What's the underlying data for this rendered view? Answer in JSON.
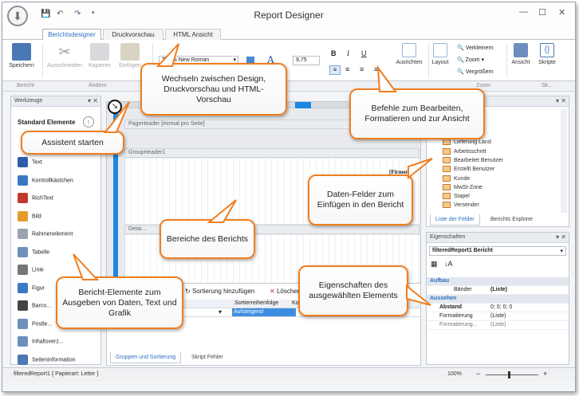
{
  "window": {
    "title": "Report Designer"
  },
  "tabs": [
    "Berichtsdesigner",
    "Druckvorschau",
    "HTML Ansicht"
  ],
  "ribbon": {
    "save": "Speichern",
    "cut": "Ausschneiden",
    "copy": "Kopieren",
    "paste": "Einfügen",
    "font_name": "Times New Roman",
    "font_size": "9,75",
    "bold": "B",
    "italic": "I",
    "underline": "U",
    "align": "Ausrichten",
    "layout": "Layout",
    "zoom_out": "Verkleinern",
    "zoom": "Zoom",
    "zoom_in": "Vergrößern",
    "view": "Ansicht",
    "scripts": "Skripte"
  },
  "groups": {
    "report": "Bericht",
    "edit": "Ändern",
    "zoom": "Zoom",
    "scripts": "Sk..."
  },
  "toolbox": {
    "title": "Werkzeuge",
    "section": "Standard Elemente",
    "items": [
      "Text",
      "Kontrollkästchen",
      "RichText",
      "Bild",
      "Rahmenelement",
      "Tabelle",
      "Linie",
      "Figur",
      "Barco...",
      "Postle...",
      "Inhaltsverz...",
      "Seiteninformation"
    ]
  },
  "bands": {
    "page_header": "PageHeader [einmal pro Seite]",
    "group_header": "GroupHeader1",
    "detail": "Detai...",
    "firm_field": "[Firmen"
  },
  "field_list": {
    "items": [
      "...ountry",
      "Lieferung Land",
      "Arbeitsschritt",
      "Bearbeitet Benutzer",
      "Erstellt Benutzer",
      "Kunde",
      "MwSt-Zone",
      "Stapel",
      "Versender"
    ],
    "tabs": [
      "Liste der Felder",
      "Berichts Explorer"
    ]
  },
  "properties": {
    "title": "Eigenschaften",
    "object": "filteredReport1",
    "object_type": "Bericht",
    "cat_build": "Aufbau",
    "bands_label": "Bänder",
    "bands_value": "(Liste)",
    "cat_look": "Aussehen",
    "padding_label": "Abstand",
    "padding_value": "0; 0; 0; 0",
    "format_label": "Formatierung",
    "format_value": "(Liste)",
    "format2_label": "Formatierung...",
    "format2_value": "(Liste)"
  },
  "grouping": {
    "add_sort": "Sortierung hinzufügen",
    "delete": "Löschen",
    "col_order": "Sortierreihenfolge",
    "col_head": "Kopfz...",
    "sort_value": "Aufsteigend",
    "tabs": [
      "Gruppen und Sortierung",
      "Skript Fehler"
    ]
  },
  "status": {
    "left": "filteredReport1 { Papierart: Letter }",
    "zoom": "100%"
  },
  "callouts": {
    "wizard": "Assistent starten",
    "switch": "Wechseln zwischen Design, Druckvorschau und HTML-Vorschau",
    "commands": "Befehle zum Bearbeiten, Formatieren und zur Ansicht",
    "fields": "Daten-Felder zum Einfügen in den Bericht",
    "areas": "Bereiche des Berichts",
    "props": "Eigenschaften des ausgewählten Elements",
    "elements": "Bericht-Elemente zum Ausgeben von Daten, Text und Grafik"
  }
}
